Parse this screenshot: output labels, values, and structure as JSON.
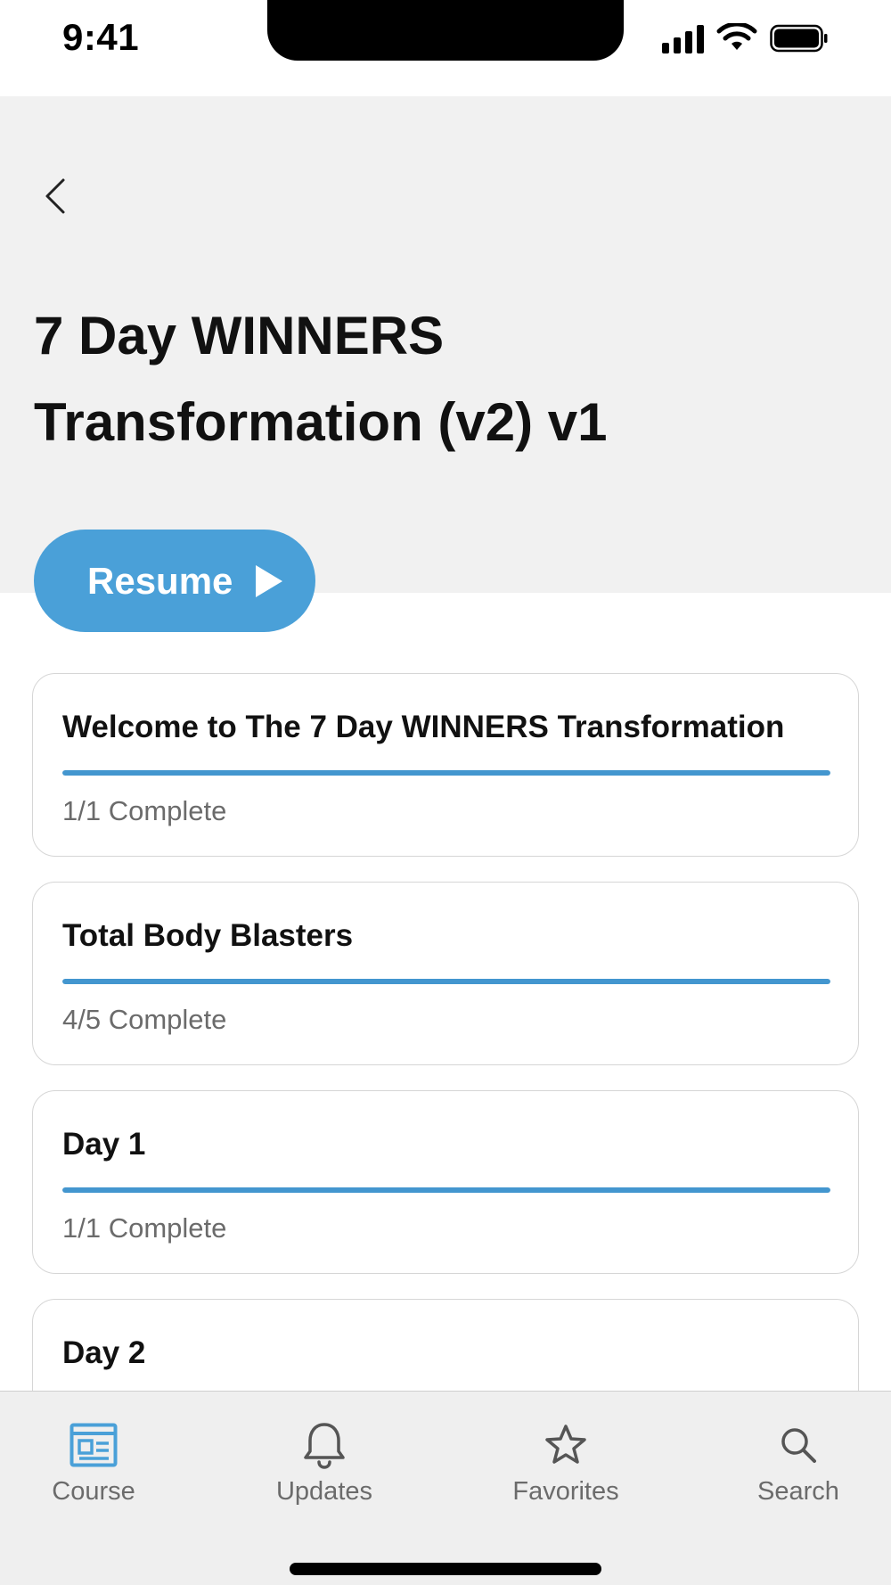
{
  "status_bar": {
    "time": "9:41"
  },
  "header": {
    "title_line1": "7 Day WINNERS",
    "title_line2": "Transformation (v2) v1",
    "resume_label": "Resume"
  },
  "modules": [
    {
      "title": "Welcome to The 7 Day WINNERS Transformation",
      "status": "1/1 Complete",
      "progress": 1.0
    },
    {
      "title": "Total Body Blasters",
      "status": "4/5 Complete",
      "progress": 1.0
    },
    {
      "title": "Day 1",
      "status": "1/1 Complete",
      "progress": 1.0
    },
    {
      "title": "Day 2",
      "status": "",
      "progress": 0
    }
  ],
  "bottom_nav": {
    "items": [
      {
        "label": "Course",
        "icon": "course-icon",
        "active": true
      },
      {
        "label": "Updates",
        "icon": "bell-icon",
        "active": false
      },
      {
        "label": "Favorites",
        "icon": "star-icon",
        "active": false
      },
      {
        "label": "Search",
        "icon": "search-icon",
        "active": false
      }
    ]
  },
  "colors": {
    "accent": "#4aa0d8",
    "progress": "#4396cf",
    "header_bg": "#f1f1f1",
    "nav_bg": "#efefef"
  }
}
